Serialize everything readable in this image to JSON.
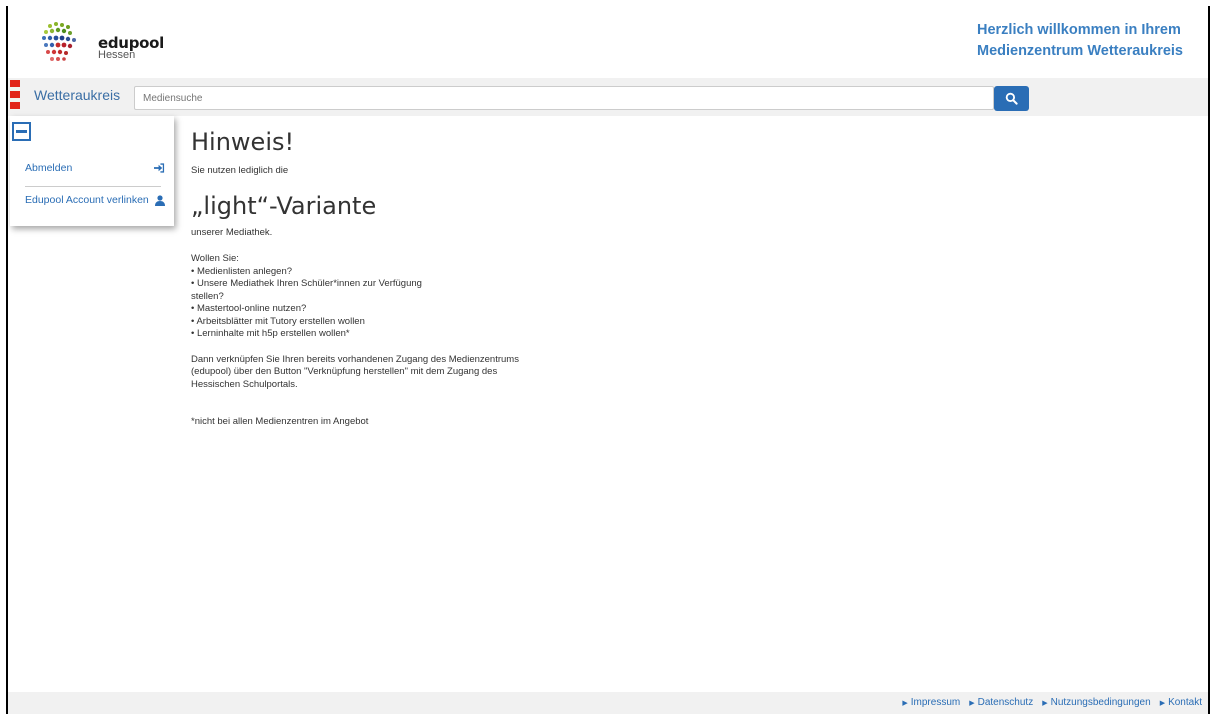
{
  "header": {
    "logo_text": "edupool",
    "logo_sub": "Hessen",
    "welcome_line1": "Herzlich willkommen in Ihrem",
    "welcome_line2": "Medienzentrum Wetteraukreis"
  },
  "navbar": {
    "region": "Wetteraukreis",
    "search_placeholder": "Mediensuche",
    "search_icon": "search-icon"
  },
  "sidebar": {
    "items": [
      {
        "label": "Abmelden",
        "icon": "sign-in-icon"
      },
      {
        "label": "Edupool Account verlinken",
        "icon": "user-icon"
      }
    ]
  },
  "main": {
    "title": "Hinweis!",
    "intro": "Sie nutzen lediglich die",
    "variant": "„light“-Variante",
    "after_variant": "unserer Mediathek.",
    "question": "Wollen Sie:",
    "bullets": [
      "• Medienlisten anlegen?",
      "• Unsere Mediathek Ihren Schüler*innen zur Verfügung",
      "stellen?",
      "• Mastertool-online nutzen?",
      "• Arbeitsblätter mit Tutory erstellen wollen",
      "• Lerninhalte mit h5p erstellen wollen*"
    ],
    "paragraph": [
      "Dann verknüpfen Sie Ihren bereits vorhandenen Zugang des Medienzentrums",
      "(edupool) über den Button \"Verknüpfung herstellen\" mit dem Zugang des",
      "Hessischen Schulportals."
    ],
    "footnote": "*nicht bei allen Medienzentren im Angebot"
  },
  "footer": {
    "links": [
      "Impressum",
      "Datenschutz",
      "Nutzungsbedingungen",
      "Kontakt"
    ]
  },
  "colors": {
    "accent": "#2a6db5",
    "welcome": "#3a7fc1",
    "brand_red": "#e2231a"
  }
}
